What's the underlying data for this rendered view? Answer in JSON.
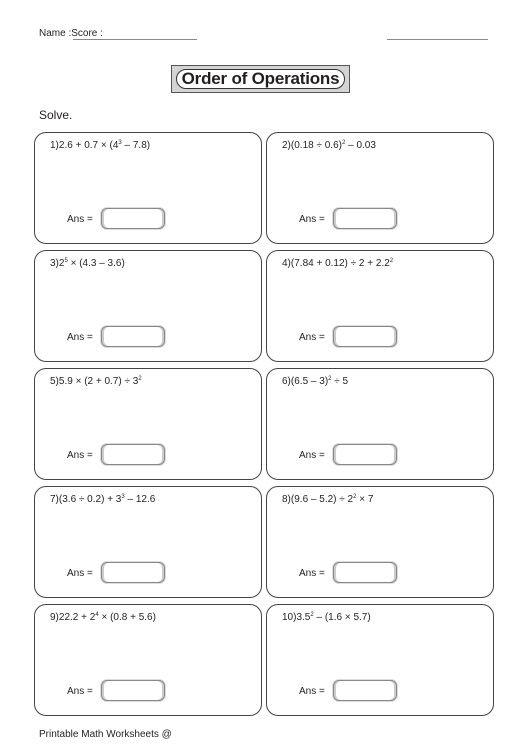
{
  "header": {
    "name_score_label": "Name :Score :"
  },
  "title": "Order of Operations",
  "instructions": "Solve.",
  "answer_label": "Ans =",
  "problems": [
    {
      "number": "1)",
      "parts": [
        {
          "t": "2.6 + 0.7 × (4"
        },
        {
          "sup": "3"
        },
        {
          "t": " – 7.8)"
        }
      ]
    },
    {
      "number": "2)",
      "parts": [
        {
          "t": "(0.18 ÷ 0.6)"
        },
        {
          "sup": "2"
        },
        {
          "t": " – 0.03"
        }
      ]
    },
    {
      "number": "3)",
      "parts": [
        {
          "t": "2"
        },
        {
          "sup": "5"
        },
        {
          "t": " × (4.3 – 3.6)"
        }
      ]
    },
    {
      "number": "4)",
      "parts": [
        {
          "t": "(7.84 + 0.12) ÷ 2 + 2.2"
        },
        {
          "sup": "2"
        }
      ]
    },
    {
      "number": "5)",
      "parts": [
        {
          "t": "5.9 × (2 + 0.7) ÷ 3"
        },
        {
          "sup": "2"
        }
      ]
    },
    {
      "number": "6)",
      "parts": [
        {
          "t": "(6.5 – 3)"
        },
        {
          "sup": "2"
        },
        {
          "t": " ÷ 5"
        }
      ]
    },
    {
      "number": "7)",
      "parts": [
        {
          "t": "(3.6 ÷ 0.2) + 3"
        },
        {
          "sup": "3"
        },
        {
          "t": " – 12.6"
        }
      ]
    },
    {
      "number": "8)",
      "parts": [
        {
          "t": "(9.6 – 5.2) ÷ 2"
        },
        {
          "sup": "2"
        },
        {
          "t": " × 7"
        }
      ]
    },
    {
      "number": "9)",
      "parts": [
        {
          "t": "22.2 + 2"
        },
        {
          "sup": "4"
        },
        {
          "t": " × (0.8 + 5.6)"
        }
      ]
    },
    {
      "number": "10)",
      "parts": [
        {
          "t": "3.5"
        },
        {
          "sup": "2"
        },
        {
          "t": " – (1.6 × 5.7)"
        }
      ]
    }
  ],
  "answers": [
    "",
    "",
    "",
    "",
    "",
    "",
    "",
    "",
    "",
    ""
  ],
  "footer": "Printable Math Worksheets @"
}
